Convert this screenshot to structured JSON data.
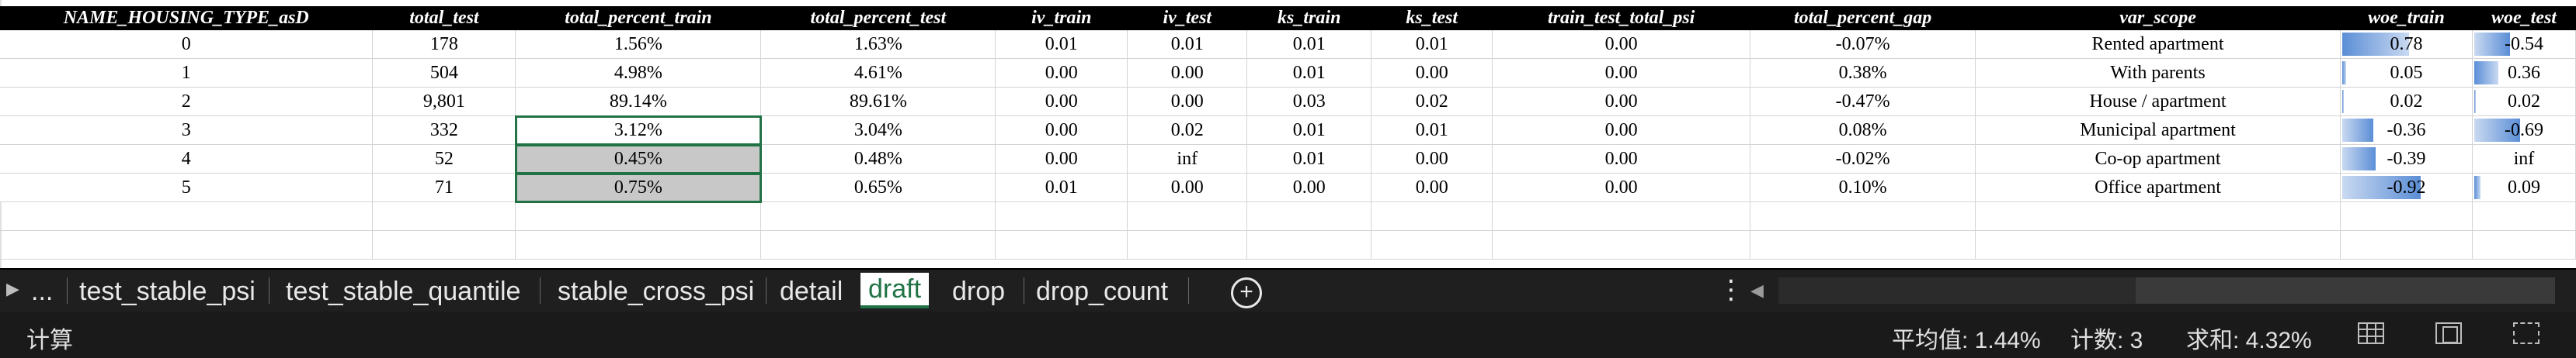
{
  "columns": [
    "NAME_HOUSING_TYPE_asD",
    "total_test",
    "total_percent_train",
    "total_percent_test",
    "iv_train",
    "iv_test",
    "ks_train",
    "ks_test",
    "train_test_total_psi",
    "total_percent_gap",
    "var_scope",
    "woe_train",
    "woe_test"
  ],
  "rows": [
    {
      "name": "0",
      "total_test": "178",
      "total_percent_train": "1.56%",
      "total_percent_test": "1.63%",
      "iv_train": "0.01",
      "iv_test": "0.01",
      "ks_train": "0.01",
      "ks_test": "0.01",
      "psi": "0.00",
      "gap": "-0.07%",
      "var_scope": "Rented apartment",
      "woe_train": "0.78",
      "woe_test": "-0.54",
      "woe_train_bar": 0.78,
      "woe_test_bar": -0.54
    },
    {
      "name": "1",
      "total_test": "504",
      "total_percent_train": "4.98%",
      "total_percent_test": "4.61%",
      "iv_train": "0.00",
      "iv_test": "0.00",
      "ks_train": "0.01",
      "ks_test": "0.00",
      "psi": "0.00",
      "gap": "0.38%",
      "var_scope": "With parents",
      "woe_train": "0.05",
      "woe_test": "0.36",
      "woe_train_bar": 0.05,
      "woe_test_bar": 0.36
    },
    {
      "name": "2",
      "total_test": "9,801",
      "total_percent_train": "89.14%",
      "total_percent_test": "89.61%",
      "iv_train": "0.00",
      "iv_test": "0.00",
      "ks_train": "0.03",
      "ks_test": "0.02",
      "psi": "0.00",
      "gap": "-0.47%",
      "var_scope": "House / apartment",
      "woe_train": "0.02",
      "woe_test": "0.02",
      "woe_train_bar": 0.02,
      "woe_test_bar": 0.02
    },
    {
      "name": "3",
      "total_test": "332",
      "total_percent_train": "3.12%",
      "total_percent_test": "3.04%",
      "iv_train": "0.00",
      "iv_test": "0.02",
      "ks_train": "0.01",
      "ks_test": "0.01",
      "psi": "0.00",
      "gap": "0.08%",
      "var_scope": "Municipal apartment",
      "woe_train": "-0.36",
      "woe_test": "-0.69",
      "woe_train_bar": -0.36,
      "woe_test_bar": -0.69
    },
    {
      "name": "4",
      "total_test": "52",
      "total_percent_train": "0.45%",
      "total_percent_test": "0.48%",
      "iv_train": "0.00",
      "iv_test": "inf",
      "ks_train": "0.01",
      "ks_test": "0.00",
      "psi": "0.00",
      "gap": "-0.02%",
      "var_scope": "Co-op apartment",
      "woe_train": "-0.39",
      "woe_test": "inf",
      "woe_train_bar": -0.39,
      "woe_test_bar": 0
    },
    {
      "name": "5",
      "total_test": "71",
      "total_percent_train": "0.75%",
      "total_percent_test": "0.65%",
      "iv_train": "0.01",
      "iv_test": "0.00",
      "ks_train": "0.00",
      "ks_test": "0.00",
      "psi": "0.00",
      "gap": "0.10%",
      "var_scope": "Office apartment",
      "woe_train": "-0.92",
      "woe_test": "0.09",
      "woe_train_bar": -0.92,
      "woe_test_bar": 0.09
    }
  ],
  "sheet_tabs": {
    "more": "...",
    "tabs": [
      "test_stable_psi",
      "test_stable_quantile",
      "stable_cross_psi",
      "detail",
      "draft",
      "drop",
      "drop_count"
    ],
    "active": "draft"
  },
  "status": {
    "mode": "计算",
    "average": "平均值: 1.44%",
    "count": "计数: 3",
    "sum": "求和: 4.32%"
  },
  "colors": {
    "accent": "#217346",
    "databar": "#5b8ed6",
    "selection_fill": "#c8c8c8"
  },
  "icons": [
    "scroll-left-icon",
    "scroll-right-icon",
    "add-sheet-icon",
    "more-options-icon",
    "normal-view-icon",
    "page-layout-view-icon",
    "page-break-view-icon"
  ]
}
